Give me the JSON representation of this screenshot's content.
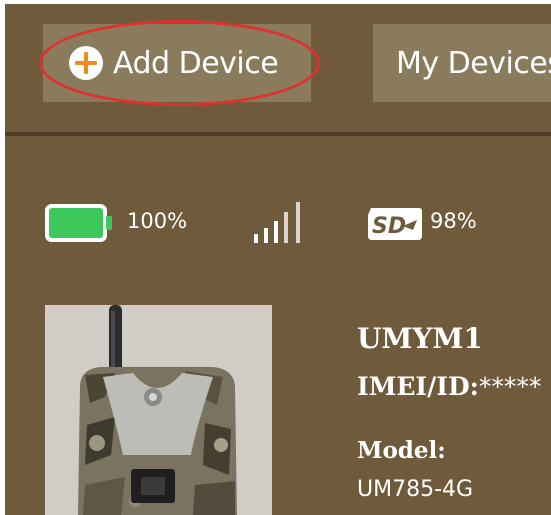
{
  "header": {
    "add_device_label": "Add Device",
    "my_devices_label": "My Devices"
  },
  "status": {
    "battery_percent": "100%",
    "battery_level": 1.0,
    "signal_bars_active": 3,
    "signal_bars_total": 5,
    "sd_percent": "98%"
  },
  "device": {
    "name": "UMYM1",
    "imei_label": "IMEI/ID:",
    "imei_value": "*****",
    "model_label": "Model:",
    "model_value": "UM785-4G"
  },
  "colors": {
    "panel_bg": "#6f5b3b",
    "button_bg": "#8b7b5d",
    "highlight_ring": "#e0302e",
    "battery_fill": "#3cc85a",
    "plus_accent": "#f28a1c"
  },
  "icons": {
    "add": "plus-circle-icon",
    "battery": "battery-icon",
    "signal": "signal-icon",
    "sd": "sd-card-icon"
  }
}
